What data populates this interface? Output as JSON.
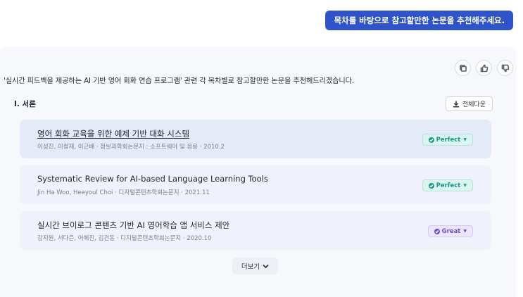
{
  "user_message": "목차를 바탕으로 참고할만한 논문을 추천해주세요.",
  "feedback": {
    "icons": [
      "copy-icon",
      "thumbs-up-icon",
      "thumbs-down-icon"
    ]
  },
  "answer": {
    "intro": "'실시간 피드백을 제공하는 AI 기반 영어 회화 연습 프로그램' 관련 각 목차별로 참고할만한 논문을 추천해드리겠습니다.",
    "section_title": "I. 서론",
    "download_label": "전체다운",
    "papers": [
      {
        "title": "영어 회화 교육을 위한 예제 기반 대화 시스템",
        "meta": "이성진, 이청재, 이근배 · 정보과학회논문지 : 소프트웨어 및 응용 · 2010.2",
        "badge": "Perfect"
      },
      {
        "title": "Systematic Review for AI-based Language Learning Tools",
        "meta": "Jin Ha Woo, Heeyoul Choi · 디지털콘텐츠학회논문지 · 2021.11",
        "badge": "Perfect"
      },
      {
        "title": "실시간 브이로그 콘텐츠 기반 AI 영어학습 앱 서비스 제안",
        "meta": "강지원, 서다은, 어혜진, 김건동 · 디지털콘텐츠학회논문지 · 2020.10",
        "badge": "Great"
      }
    ],
    "more_label": "더보기"
  },
  "colors": {
    "accent": "#2f54c9",
    "perfect": "#179a86",
    "great": "#6a4fd1"
  }
}
